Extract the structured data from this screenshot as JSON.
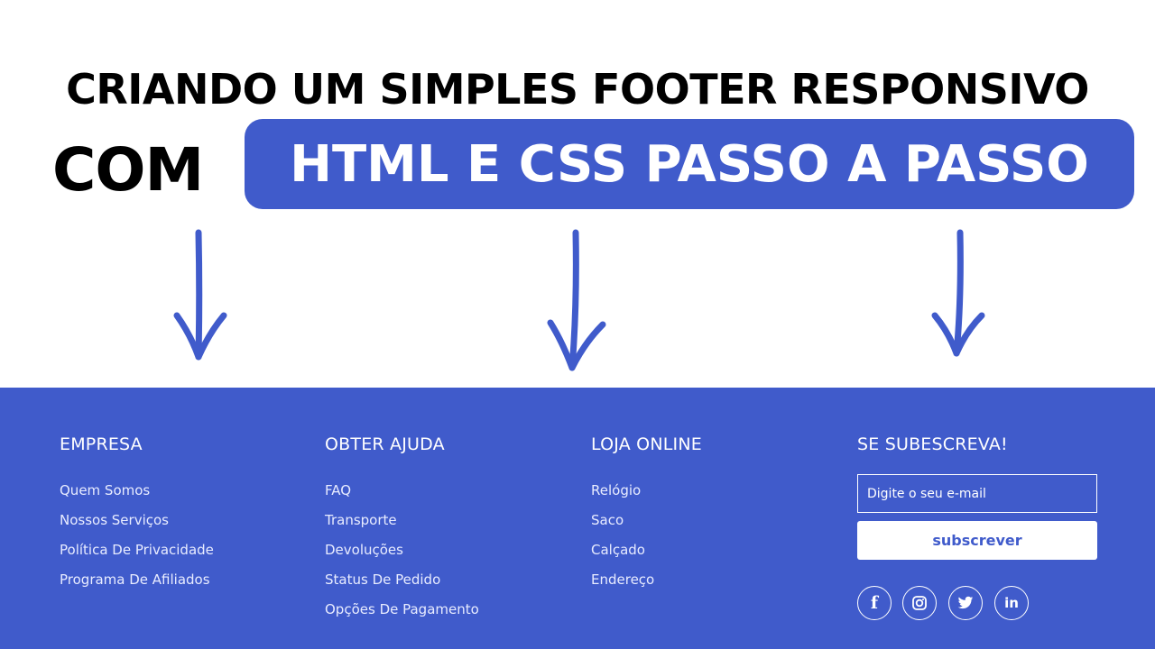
{
  "hero": {
    "line1": "CRIANDO UM SIMPLES FOOTER RESPONSIVO",
    "line2_prefix": "COM",
    "line2_highlight": "HTML E CSS PASSO A PASSO"
  },
  "colors": {
    "brand": "#405bcb",
    "text_on_brand": "#ffffff"
  },
  "footer": {
    "columns": [
      {
        "title": "EMPRESA",
        "links": [
          "Quem Somos",
          "Nossos Serviços",
          "Política De Privacidade",
          "Programa De Afiliados"
        ]
      },
      {
        "title": "OBTER AJUDA",
        "links": [
          "FAQ",
          "Transporte",
          "Devoluções",
          "Status De Pedido",
          "Opções De Pagamento"
        ]
      },
      {
        "title": "LOJA ONLINE",
        "links": [
          "Relógio",
          "Saco",
          "Calçado",
          "Endereço"
        ]
      }
    ],
    "subscribe": {
      "title": "SE SUBESCREVA!",
      "email_placeholder": "Digite o seu e-mail",
      "button_label": "subscrever"
    },
    "social": [
      {
        "icon": "facebook-icon",
        "glyph": "f"
      },
      {
        "icon": "instagram-icon",
        "glyph": ""
      },
      {
        "icon": "twitter-icon",
        "glyph": ""
      },
      {
        "icon": "linkedin-icon",
        "glyph": "in"
      }
    ]
  }
}
